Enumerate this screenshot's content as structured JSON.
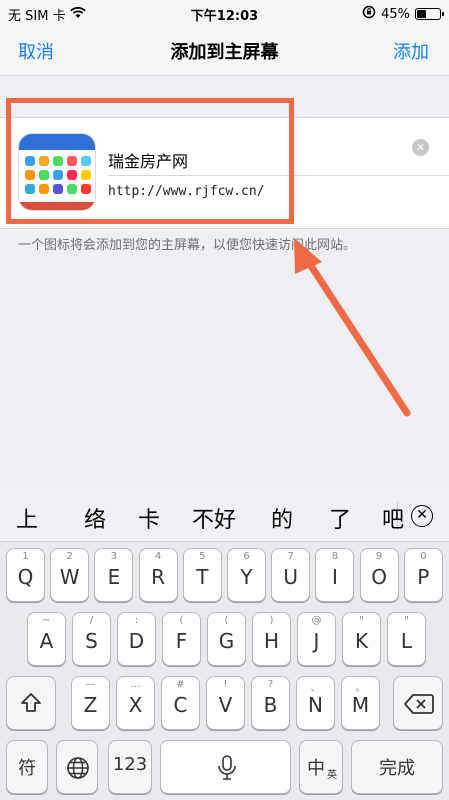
{
  "status_bar": {
    "carrier": "无 SIM 卡",
    "time": "下午12:03",
    "battery": "45%",
    "battery_level": 0.45
  },
  "nav": {
    "cancel": "取消",
    "title": "添加到主屏幕",
    "add": "添加"
  },
  "bookmark": {
    "name": "瑞金房产网",
    "url": "http://www.rjfcw.cn/"
  },
  "hint": "一个图标将会添加到您的主屏幕，以便您快速访问此网站。",
  "annotation_color": "#f26a45",
  "keyboard": {
    "candidates": [
      "上",
      "络",
      "卡",
      "不好",
      "的",
      "了",
      "吧"
    ],
    "row1": [
      {
        "main": "Q",
        "hint": "1"
      },
      {
        "main": "W",
        "hint": "2"
      },
      {
        "main": "E",
        "hint": "3"
      },
      {
        "main": "R",
        "hint": "4"
      },
      {
        "main": "T",
        "hint": "5"
      },
      {
        "main": "Y",
        "hint": "6"
      },
      {
        "main": "U",
        "hint": "7"
      },
      {
        "main": "I",
        "hint": "8"
      },
      {
        "main": "O",
        "hint": "9"
      },
      {
        "main": "P",
        "hint": "0"
      }
    ],
    "row2": [
      {
        "main": "A",
        "hint": "~"
      },
      {
        "main": "S",
        "hint": "/"
      },
      {
        "main": "D",
        "hint": ":"
      },
      {
        "main": "F",
        "hint": "("
      },
      {
        "main": "G",
        "hint": "("
      },
      {
        "main": "H",
        "hint": ")"
      },
      {
        "main": "J",
        "hint": "@"
      },
      {
        "main": "K",
        "hint": "\""
      },
      {
        "main": "L",
        "hint": "\""
      }
    ],
    "row3": [
      {
        "main": "Z",
        "hint": "—"
      },
      {
        "main": "X",
        "hint": "…"
      },
      {
        "main": "C",
        "hint": "#"
      },
      {
        "main": "V",
        "hint": "!"
      },
      {
        "main": "B",
        "hint": "?"
      },
      {
        "main": "N",
        "hint": "、"
      },
      {
        "main": "M",
        "hint": "。"
      }
    ],
    "symbol_key": "符",
    "numbers_key": "123",
    "lang_key": "中",
    "lang_key_sub": "英",
    "done_key": "完成"
  }
}
